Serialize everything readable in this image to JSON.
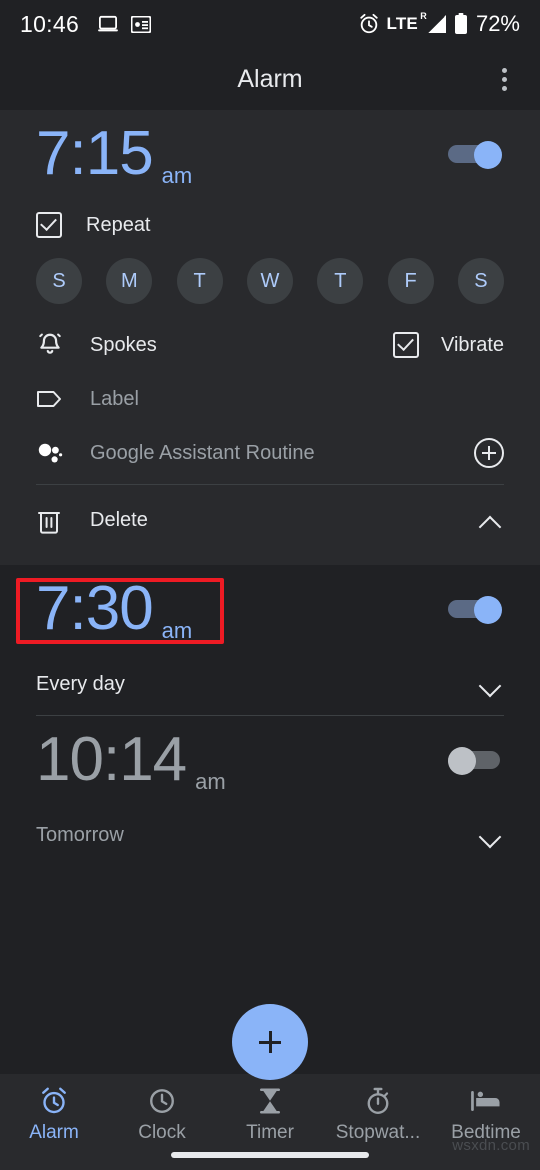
{
  "status_bar": {
    "clock": "10:46",
    "left_icons": [
      "laptop-icon",
      "news-card-icon"
    ],
    "alarm_icon": "alarm-clock-icon",
    "network_label": "LTE",
    "network_superscript": "R",
    "signal_icon": "signal-bars-icon",
    "battery_icon": "battery-icon",
    "battery_percent": "72%"
  },
  "app_bar": {
    "title": "Alarm",
    "overflow_menu": "more-options"
  },
  "alarms": [
    {
      "time": "7:15",
      "meridiem": "am",
      "enabled": true,
      "expanded": true,
      "repeat_label": "Repeat",
      "repeat_checked": true,
      "days": [
        {
          "letter": "S",
          "name": "sunday",
          "selected": false
        },
        {
          "letter": "M",
          "name": "monday",
          "selected": false
        },
        {
          "letter": "T",
          "name": "tuesday",
          "selected": false
        },
        {
          "letter": "W",
          "name": "wednesday",
          "selected": false
        },
        {
          "letter": "T",
          "name": "thursday",
          "selected": false
        },
        {
          "letter": "F",
          "name": "friday",
          "selected": false
        },
        {
          "letter": "S",
          "name": "saturday",
          "selected": false
        }
      ],
      "ringtone_label": "Spokes",
      "vibrate_label": "Vibrate",
      "vibrate_checked": true,
      "label_field": "Label",
      "assistant_routine": "Google Assistant Routine",
      "delete_label": "Delete"
    },
    {
      "time": "7:30",
      "meridiem": "am",
      "enabled": true,
      "schedule": "Every day"
    },
    {
      "time": "10:14",
      "meridiem": "am",
      "enabled": false,
      "schedule": "Tomorrow"
    }
  ],
  "fab": {
    "label": "add-alarm"
  },
  "bottom_nav": [
    {
      "label": "Alarm",
      "icon": "alarm-clock-icon",
      "active": true
    },
    {
      "label": "Clock",
      "icon": "clock-icon",
      "active": false
    },
    {
      "label": "Timer",
      "icon": "hourglass-icon",
      "active": false
    },
    {
      "label": "Stopwat...",
      "icon": "stopwatch-icon",
      "active": false
    },
    {
      "label": "Bedtime",
      "icon": "bed-icon",
      "active": false
    }
  ],
  "watermark": "wsxdn.com",
  "colors": {
    "accent": "#8ab4f8",
    "background": "#202124",
    "card": "#292a2d",
    "text_primary": "#e8eaed",
    "text_secondary": "#9aa0a6",
    "annotation": "#ee1b24"
  }
}
